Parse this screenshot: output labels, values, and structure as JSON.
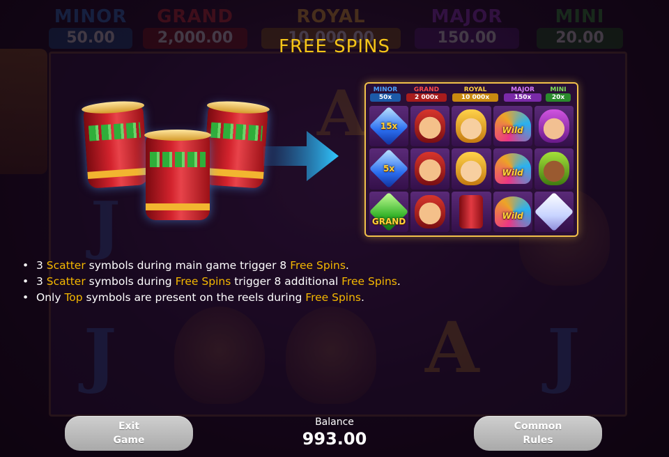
{
  "jackpots": [
    {
      "name": "MINOR",
      "value": "50.00",
      "color": "#2e7fd4"
    },
    {
      "name": "GRAND",
      "value": "2,000.00",
      "color": "#d32f2f"
    },
    {
      "name": "ROYAL",
      "value": "10,000.00",
      "color": "#f2b530"
    },
    {
      "name": "MAJOR",
      "value": "150.00",
      "color": "#9b3ad1"
    },
    {
      "name": "MINI",
      "value": "20.00",
      "color": "#37a53a"
    }
  ],
  "overlay": {
    "title": "FREE SPINS",
    "preview": {
      "jackpots": [
        {
          "name": "MINOR",
          "value": "50x"
        },
        {
          "name": "GRAND",
          "value": "2 000x"
        },
        {
          "name": "ROYAL",
          "value": "10 000x"
        },
        {
          "name": "MAJOR",
          "value": "150x"
        },
        {
          "name": "MINI",
          "value": "20x"
        }
      ],
      "cell_labels": {
        "gem1": "15x",
        "gem2": "5x",
        "gem3": "GRAND",
        "wild": "Wild"
      }
    },
    "rules": [
      {
        "parts": [
          {
            "t": "3 "
          },
          {
            "t": "Scatter",
            "hl": true
          },
          {
            "t": " symbols during main game trigger 8 "
          },
          {
            "t": "Free Spins",
            "hl": true
          },
          {
            "t": "."
          }
        ]
      },
      {
        "parts": [
          {
            "t": "3 "
          },
          {
            "t": "Scatter",
            "hl": true
          },
          {
            "t": " symbols during "
          },
          {
            "t": "Free Spins",
            "hl": true
          },
          {
            "t": " trigger 8 additional "
          },
          {
            "t": "Free Spins",
            "hl": true
          },
          {
            "t": "."
          }
        ]
      },
      {
        "parts": [
          {
            "t": "Only "
          },
          {
            "t": "Top",
            "hl": true
          },
          {
            "t": " symbols are present on the reels during "
          },
          {
            "t": "Free Spins",
            "hl": true
          },
          {
            "t": "."
          }
        ]
      }
    ]
  },
  "bottom": {
    "exit": {
      "line1": "Exit",
      "line2": "Game"
    },
    "balance": {
      "label": "Balance",
      "amount": "993.00"
    },
    "rules_btn": {
      "line1": "Common",
      "line2": "Rules"
    }
  },
  "colors": {
    "highlight": "#f5b800",
    "title": "#f5c518"
  }
}
